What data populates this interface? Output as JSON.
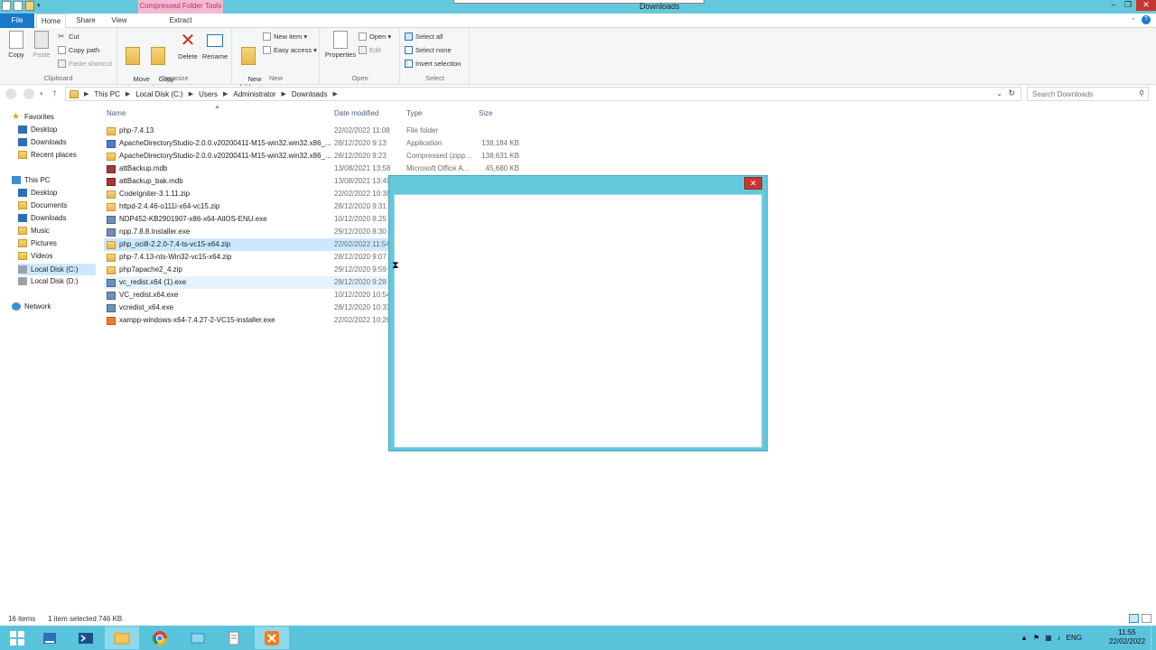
{
  "window": {
    "title": "Downloads",
    "context_tab": "Compressed Folder Tools",
    "controls": {
      "minimize": "–",
      "maximize": "❐",
      "close": "✕"
    }
  },
  "ribbon_tabs": {
    "file": "File",
    "home": "Home",
    "share": "Share",
    "view": "View",
    "extract": "Extract"
  },
  "ribbon": {
    "clipboard": {
      "label": "Clipboard",
      "copy": "Copy",
      "paste": "Paste",
      "cut": "Cut",
      "copy_path": "Copy path",
      "paste_shortcut": "Paste shortcut"
    },
    "organize": {
      "label": "Organize",
      "move_to": "Move\nto ▾",
      "copy_to": "Copy\nto ▾",
      "delete": "Delete",
      "rename": "Rename"
    },
    "new": {
      "label": "New",
      "new_folder": "New\nfolder",
      "new_item": "New item ▾",
      "easy_access": "Easy access ▾"
    },
    "open": {
      "label": "Open",
      "properties": "Properties",
      "open": "Open ▾",
      "edit": "Edit"
    },
    "select": {
      "label": "Select",
      "select_all": "Select all",
      "select_none": "Select none",
      "invert_selection": "Invert selection"
    }
  },
  "address": {
    "crumbs": [
      "This PC",
      "Local Disk (C:)",
      "Users",
      "Administrator",
      "Downloads"
    ],
    "search_placeholder": "Search Downloads"
  },
  "nav": {
    "favorites": "Favorites",
    "desktop": "Desktop",
    "downloads": "Downloads",
    "recent": "Recent places",
    "this_pc": "This PC",
    "pc_desktop": "Desktop",
    "documents": "Documents",
    "pc_downloads": "Downloads",
    "music": "Music",
    "pictures": "Pictures",
    "videos": "Videos",
    "disk_c": "Local Disk (C:)",
    "disk_d": "Local Disk (D:)",
    "network": "Network"
  },
  "columns": {
    "name": "Name",
    "date": "Date modified",
    "type": "Type",
    "size": "Size"
  },
  "files": [
    {
      "name": "php-7.4.13",
      "date": "22/02/2022 11:08",
      "type": "File folder",
      "size": "",
      "icon": "folder-icon"
    },
    {
      "name": "ApacheDirectoryStudio-2.0.0.v20200411-M15-win32.win32.x86_...",
      "date": "28/12/2020 9:13",
      "type": "Application",
      "size": "138,184 KB",
      "icon": "app-icon"
    },
    {
      "name": "ApacheDirectoryStudio-2.0.0.v20200411-M15-win32.win32.x86_...",
      "date": "28/12/2020 9:23",
      "type": "Compressed (zipp...",
      "size": "138,631 KB",
      "icon": "zip-icon"
    },
    {
      "name": "attBackup.mdb",
      "date": "13/08/2021 13:58",
      "type": "Microsoft Office A...",
      "size": "45,680 KB",
      "icon": "access-icon"
    },
    {
      "name": "attBackup_bak.mdb",
      "date": "13/08/2021 13:49",
      "type": "",
      "size": "",
      "icon": "access-icon"
    },
    {
      "name": "CodeIgniter-3.1.11.zip",
      "date": "22/02/2022 10:38",
      "type": "",
      "size": "",
      "icon": "zip-icon"
    },
    {
      "name": "httpd-2.4.46-o111i-x64-vc15.zip",
      "date": "28/12/2020 9:31",
      "type": "",
      "size": "",
      "icon": "zip-icon"
    },
    {
      "name": "NDP452-KB2901907-x86-x64-AllOS-ENU.exe",
      "date": "10/12/2020 8:25",
      "type": "",
      "size": "",
      "icon": "exe-icon"
    },
    {
      "name": "npp.7.8.8.Installer.exe",
      "date": "29/12/2020 8:30",
      "type": "",
      "size": "",
      "icon": "exe-icon"
    },
    {
      "name": "php_oci8-2.2.0-7.4-ts-vc15-x64.zip",
      "date": "22/02/2022 11:54",
      "type": "",
      "size": "",
      "icon": "zip-icon"
    },
    {
      "name": "php-7.4.13-nts-Win32-vc15-x64.zip",
      "date": "28/12/2020 9:07",
      "type": "",
      "size": "",
      "icon": "zip-icon"
    },
    {
      "name": "php7apache2_4.zip",
      "date": "29/12/2020 9:59",
      "type": "",
      "size": "",
      "icon": "zip-icon"
    },
    {
      "name": "vc_redist.x64 (1).exe",
      "date": "28/12/2020 9:28",
      "type": "",
      "size": "",
      "icon": "exe-icon"
    },
    {
      "name": "VC_redist.x64.exe",
      "date": "10/12/2020 10:54",
      "type": "",
      "size": "",
      "icon": "exe-icon"
    },
    {
      "name": "vcredist_x64.exe",
      "date": "28/12/2020 10:33",
      "type": "",
      "size": "",
      "icon": "exe-icon"
    },
    {
      "name": "xampp-windows-x64-7.4.27-2-VC15-installer.exe",
      "date": "22/02/2022 10:26",
      "type": "",
      "size": "",
      "icon": "xampp-icon"
    }
  ],
  "popup": {
    "close": "✕"
  },
  "status": {
    "count": "16 items",
    "selected": "1 item selected",
    "size": "746 KB"
  },
  "tray": {
    "lang": "ENG",
    "time": "11:55",
    "date": "22/02/2022"
  },
  "colors": {
    "title_bar": "#64c8dc",
    "taskbar": "#5ac3dc",
    "file_tab": "#1979ca",
    "selection": "#cce8ff",
    "close": "#c7372f"
  }
}
